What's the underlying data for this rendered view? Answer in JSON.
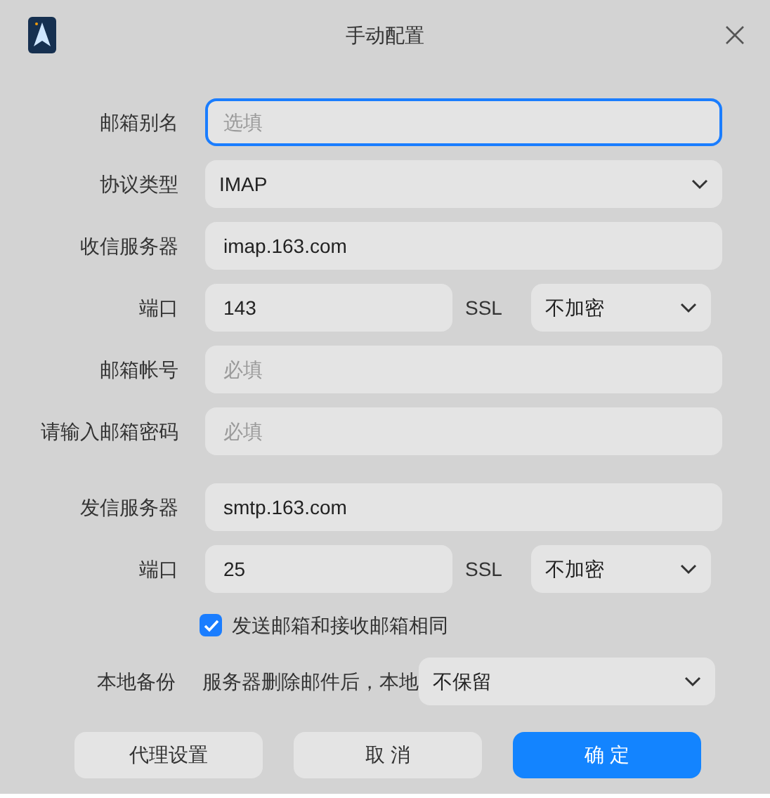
{
  "window": {
    "title": "手动配置"
  },
  "incoming": [
    {
      "kind": "text",
      "label": "邮箱别名",
      "placeholder": "选填",
      "focused": true
    },
    {
      "kind": "select",
      "label": "协议类型",
      "value": "IMAP"
    },
    {
      "kind": "text",
      "label": "收信服务器",
      "value": "imap.163.com",
      "focused": false
    },
    {
      "kind": "port",
      "label": "端口",
      "value": "143",
      "ssl_label": "SSL",
      "ssl_value": "不加密"
    },
    {
      "kind": "text",
      "label": "邮箱帐号",
      "placeholder": "必填",
      "focused": false
    },
    {
      "kind": "text",
      "label": "请输入邮箱密码",
      "placeholder": "必填",
      "focused": false
    }
  ],
  "outgoing": [
    {
      "kind": "text",
      "label": "发信服务器",
      "value": "smtp.163.com",
      "focused": false
    },
    {
      "kind": "port",
      "label": "端口",
      "value": "25",
      "ssl_label": "SSL",
      "ssl_value": "不加密"
    }
  ],
  "same_mailbox": {
    "label": "发送邮箱和接收邮箱相同",
    "checked": true
  },
  "backup": {
    "label": "本地备份",
    "prefix": "服务器删除邮件后，本地",
    "value": "不保留"
  },
  "buttons": [
    {
      "label": "代理设置",
      "primary": false
    },
    {
      "label": "取 消",
      "primary": false
    },
    {
      "label": "确 定",
      "primary": true
    }
  ]
}
